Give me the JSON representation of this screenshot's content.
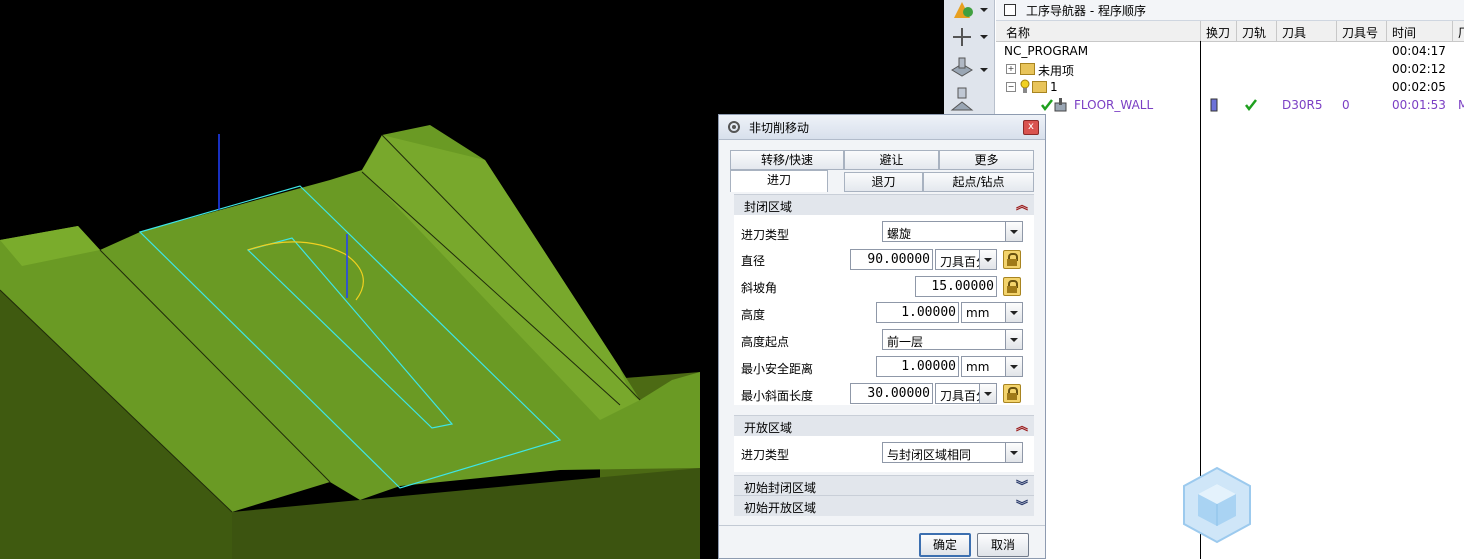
{
  "navigator": {
    "title": "工序导航器 - 程序顺序",
    "columns": [
      "名称",
      "换刀",
      "刀轨",
      "刀具",
      "刀具号",
      "时间",
      "厂"
    ],
    "rows": [
      {
        "name": "NC_PROGRAM",
        "time": "00:04:17"
      },
      {
        "name": "未用项",
        "time": "00:02:12"
      },
      {
        "name": "1",
        "time": "00:02:05"
      },
      {
        "name": "FLOOR_WALL",
        "tool": "D30R5",
        "tool_number": "0",
        "time": "00:01:53",
        "extra": "M"
      }
    ]
  },
  "dialog": {
    "title": "非切削移动",
    "tabs_row1": [
      "转移/快速",
      "避让",
      "更多"
    ],
    "tabs_row2": [
      "进刀",
      "退刀",
      "起点/钻点"
    ],
    "closed_section": "封闭区域",
    "fields": {
      "entry_type_label": "进刀类型",
      "entry_type_value": "螺旋",
      "diameter_label": "直径",
      "diameter_value": "90.00000",
      "diameter_unit": "刀具百分比",
      "ramp_label": "斜坡角",
      "ramp_value": "15.00000",
      "height_label": "高度",
      "height_value": "1.00000",
      "height_unit": "mm",
      "height_from_label": "高度起点",
      "height_from_value": "前一层",
      "min_clear_label": "最小安全距离",
      "min_clear_value": "1.00000",
      "min_clear_unit": "mm",
      "min_ramp_label": "最小斜面长度",
      "min_ramp_value": "30.00000",
      "min_ramp_unit": "刀具百分比"
    },
    "open_section": "开放区域",
    "open_entry_label": "进刀类型",
    "open_entry_value": "与封闭区域相同",
    "initial_closed": "初始封闭区域",
    "initial_open": "初始开放区域",
    "ok": "确定",
    "cancel": "取消"
  }
}
